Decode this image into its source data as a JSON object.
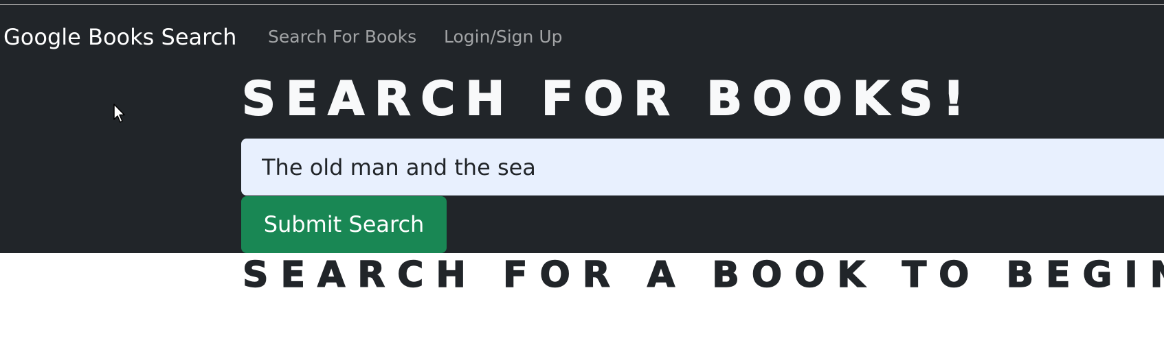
{
  "navbar": {
    "brand": "Google Books Search",
    "links": [
      {
        "label": "Search For Books"
      },
      {
        "label": "Login/Sign Up"
      }
    ]
  },
  "hero": {
    "title": "Search for Books!"
  },
  "search": {
    "value": "The old man and the sea",
    "submit_label": "Submit Search"
  },
  "results": {
    "heading": "Search for a book to begin"
  },
  "icons": {
    "cursor": "mouse-pointer-icon"
  },
  "colors": {
    "dark_background": "#212529",
    "input_background": "#e8f0fe",
    "submit_button": "#198754",
    "nav_link": "rgba(255,255,255,0.58)"
  }
}
